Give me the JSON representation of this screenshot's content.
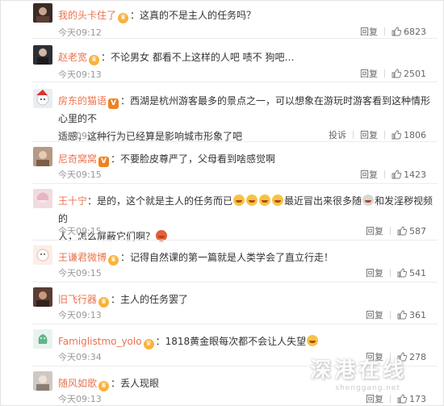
{
  "colors": {
    "name": "#eb7350",
    "text": "#333333",
    "muted": "#999999",
    "badge": "#f3a23a",
    "vip": "#f08220"
  },
  "actions": {
    "reply": "回复",
    "report": "投诉"
  },
  "watermark": {
    "main": "深港在线",
    "sub": "shenggang.net"
  },
  "comments": [
    {
      "name": "我的头卡住了",
      "badge": "crown",
      "text": "：这真的不是主人的任务吗？",
      "time": "今天09:12",
      "likes": "6823"
    },
    {
      "name": "赵老宽",
      "badge": "crown",
      "text": "：不论男女 都看不上这样的人吧 啧不 狗吧…",
      "time": "今天09:13",
      "likes": "2501"
    },
    {
      "name": "房东的猫语",
      "badge": "vip",
      "text_line1": "：西湖是杭州游客最多的景点之一，可以想象在游玩时游客看到这种情形心里的不",
      "text_line2": "适感，这种行为已经算是影响城市形象了吧",
      "time": "今天09:13",
      "likes": "1806"
    },
    {
      "name": "尼奇窝窝",
      "badge": "vip",
      "text": "：不要脸皮尊严了，父母看到啥感觉啊",
      "time": "今天09:15",
      "likes": "1423"
    },
    {
      "name": "王十宁",
      "badge": "",
      "text_part1": "：是的，这个就是主人的任务而已",
      "text_part2": "最近冒出来很多随",
      "text_part3": "和发淫秽视频的",
      "text_line2a": "人，怎么屏蔽它们啊？",
      "time": "今天09:15",
      "likes": "587"
    },
    {
      "name": "王谦君微博",
      "badge": "crown",
      "text": "：记得自然课的第一篇就是人类学会了直立行走！",
      "time": "今天09:15",
      "likes": "541"
    },
    {
      "name": "旧飞行器",
      "badge": "crown",
      "text": "：主人的任务罢了",
      "time": "今天09:13",
      "likes": "361"
    },
    {
      "name": "Famiglistmo_yolo",
      "badge": "crown",
      "text": "：1818黄金眼每次都不会让人失望",
      "time": "今天09:34",
      "likes": "278"
    },
    {
      "name": "随风如歌",
      "badge": "crown",
      "text": "：丢人现眼",
      "time": "今天09:13",
      "likes": "173"
    }
  ]
}
